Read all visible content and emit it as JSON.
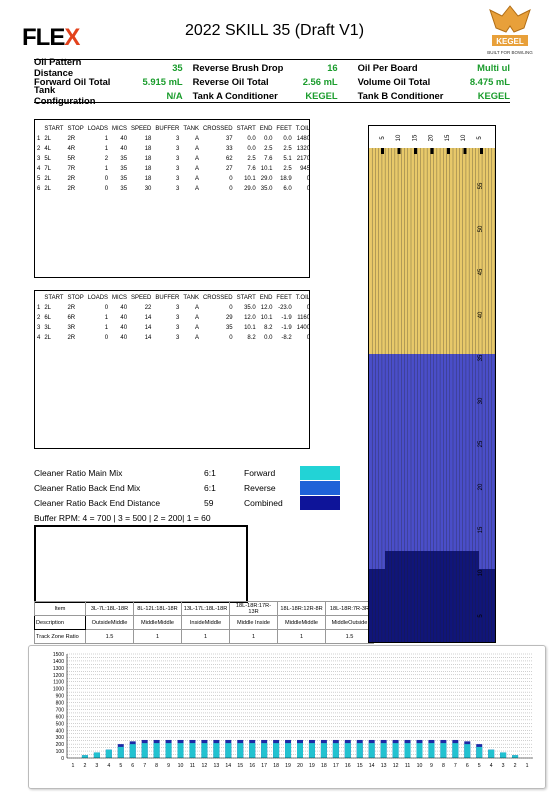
{
  "header": {
    "logo_text": "FLE",
    "logo_x": "X",
    "title": "2022 SKILL 35 (Draft V1)",
    "kegel_logo_text": "KEGEL",
    "kegel_tagline": "BUILT FOR BOWLING"
  },
  "info": [
    [
      {
        "label": "Oil Pattern Distance",
        "value": "35"
      },
      {
        "label": "Reverse Brush Drop",
        "value": "16"
      },
      {
        "label": "Oil Per Board",
        "value": "Multi ul"
      }
    ],
    [
      {
        "label": "Forward Oil Total",
        "value": "5.915 mL"
      },
      {
        "label": "Reverse Oil Total",
        "value": "2.56 mL"
      },
      {
        "label": "Volume Oil Total",
        "value": "8.475 mL"
      }
    ],
    [
      {
        "label": "Tank Configuration",
        "value": "N/A"
      },
      {
        "label": "Tank A Conditioner",
        "value": "KEGEL"
      },
      {
        "label": "Tank B Conditioner",
        "value": "KEGEL"
      }
    ]
  ],
  "forward_table": {
    "headers": [
      "",
      "START",
      "STOP",
      "LOADS",
      "MICS",
      "SPEED",
      "BUFFER",
      "TANK",
      "CROSSED",
      "START",
      "END",
      "FEET",
      "T.OIL"
    ],
    "rows": [
      [
        "1",
        "2L",
        "2R",
        "1",
        "40",
        "18",
        "3",
        "A",
        "37",
        "0.0",
        "0.0",
        "0.0",
        "1480"
      ],
      [
        "2",
        "4L",
        "4R",
        "1",
        "40",
        "18",
        "3",
        "A",
        "33",
        "0.0",
        "2.5",
        "2.5",
        "1320"
      ],
      [
        "3",
        "5L",
        "5R",
        "2",
        "35",
        "18",
        "3",
        "A",
        "62",
        "2.5",
        "7.6",
        "5.1",
        "2170"
      ],
      [
        "4",
        "7L",
        "7R",
        "1",
        "35",
        "18",
        "3",
        "A",
        "27",
        "7.6",
        "10.1",
        "2.5",
        "945"
      ],
      [
        "5",
        "2L",
        "2R",
        "0",
        "35",
        "18",
        "3",
        "A",
        "0",
        "10.1",
        "29.0",
        "18.9",
        "0"
      ],
      [
        "6",
        "2L",
        "2R",
        "0",
        "35",
        "30",
        "3",
        "A",
        "0",
        "29.0",
        "35.0",
        "6.0",
        "0"
      ]
    ]
  },
  "reverse_table": {
    "headers": [
      "",
      "START",
      "STOP",
      "LOADS",
      "MICS",
      "SPEED",
      "BUFFER",
      "TANK",
      "CROSSED",
      "START",
      "END",
      "FEET",
      "T.OIL"
    ],
    "rows": [
      [
        "1",
        "2L",
        "2R",
        "0",
        "40",
        "22",
        "3",
        "A",
        "0",
        "35.0",
        "12.0",
        "-23.0",
        "0"
      ],
      [
        "2",
        "6L",
        "6R",
        "1",
        "40",
        "14",
        "3",
        "A",
        "29",
        "12.0",
        "10.1",
        "-1.9",
        "1160"
      ],
      [
        "3",
        "3L",
        "3R",
        "1",
        "40",
        "14",
        "3",
        "A",
        "35",
        "10.1",
        "8.2",
        "-1.9",
        "1400"
      ],
      [
        "4",
        "2L",
        "2R",
        "0",
        "40",
        "14",
        "3",
        "A",
        "0",
        "8.2",
        "0.0",
        "-8.2",
        "0"
      ]
    ]
  },
  "cleaner": {
    "main_mix_label": "Cleaner Ratio Main Mix",
    "main_mix_value": "6:1",
    "back_end_mix_label": "Cleaner Ratio Back End Mix",
    "back_end_mix_value": "6:1",
    "back_end_distance_label": "Cleaner Ratio Back End Distance",
    "back_end_distance_value": "59",
    "buffer_rpm": "Buffer RPM: 4 = 700 | 3 = 500 | 2 = 200| 1 = 60"
  },
  "legend": [
    {
      "label": "Forward",
      "color": "#22d3d6"
    },
    {
      "label": "Reverse",
      "color": "#1f62d8"
    },
    {
      "label": "Combined",
      "color": "#0e1499"
    }
  ],
  "track_zone": {
    "item_header": "Item",
    "columns": [
      "3L-7L:18L-18R",
      "8L-12L:18L-18R",
      "13L-17L:18L-18R",
      "18L-18R:17R-13R",
      "18L-18R:12R-8R",
      "18L-18R:7R-3R"
    ],
    "desc_label": "Description",
    "descriptions": [
      "OutsideMiddle",
      "MiddleMiddle",
      "InsideMiddle",
      "Middle Inside",
      "MiddleMiddle",
      "MiddleOutside"
    ],
    "ratio_label": "Track Zone Ratio",
    "ratios": [
      "1.5",
      "1",
      "1",
      "1",
      "1",
      "1.5"
    ]
  },
  "lane_graphic": {
    "top_board_labels": [
      "5",
      "10",
      "15",
      "20",
      "15",
      "10",
      "5"
    ],
    "distance_labels": [
      "55",
      "50",
      "45",
      "40",
      "35",
      "30",
      "25",
      "20",
      "15",
      "10",
      "5"
    ],
    "oil_color": "#e8c96a",
    "reverse_color": "#4a4ec9",
    "combined_color": "#10157a"
  },
  "chart_data": {
    "type": "bar",
    "categories": [
      "1",
      "2",
      "3",
      "4",
      "5",
      "6",
      "7",
      "8",
      "9",
      "10",
      "11",
      "12",
      "13",
      "14",
      "15",
      "16",
      "17",
      "18",
      "19",
      "20",
      "19",
      "18",
      "17",
      "16",
      "15",
      "14",
      "13",
      "12",
      "11",
      "10",
      "9",
      "8",
      "7",
      "6",
      "5",
      "4",
      "3",
      "2",
      "1"
    ],
    "series": [
      {
        "name": "Forward",
        "values": [
          0,
          40,
          80,
          120,
          160,
          200,
          215,
          215,
          215,
          215,
          215,
          215,
          215,
          215,
          215,
          215,
          215,
          215,
          215,
          215,
          215,
          215,
          215,
          215,
          215,
          215,
          215,
          215,
          215,
          215,
          215,
          215,
          215,
          200,
          160,
          120,
          80,
          40,
          0
        ]
      },
      {
        "name": "Combined",
        "values": [
          0,
          40,
          80,
          120,
          200,
          240,
          260,
          260,
          260,
          260,
          260,
          260,
          260,
          260,
          260,
          260,
          260,
          260,
          260,
          260,
          260,
          260,
          260,
          260,
          260,
          260,
          260,
          260,
          260,
          260,
          260,
          260,
          260,
          240,
          200,
          120,
          80,
          40,
          0
        ]
      }
    ],
    "yticks": [
      "0",
      "50",
      "100",
      "150",
      "200",
      "250",
      "300",
      "350",
      "400",
      "450",
      "500",
      "550",
      "600",
      "650",
      "700",
      "750",
      "800",
      "850",
      "900",
      "950",
      "1000",
      "1050",
      "1100",
      "1150",
      "1200",
      "1250",
      "1300",
      "1350",
      "1400",
      "1450",
      "1500"
    ],
    "ylim": [
      0,
      1500
    ],
    "grid": true
  }
}
